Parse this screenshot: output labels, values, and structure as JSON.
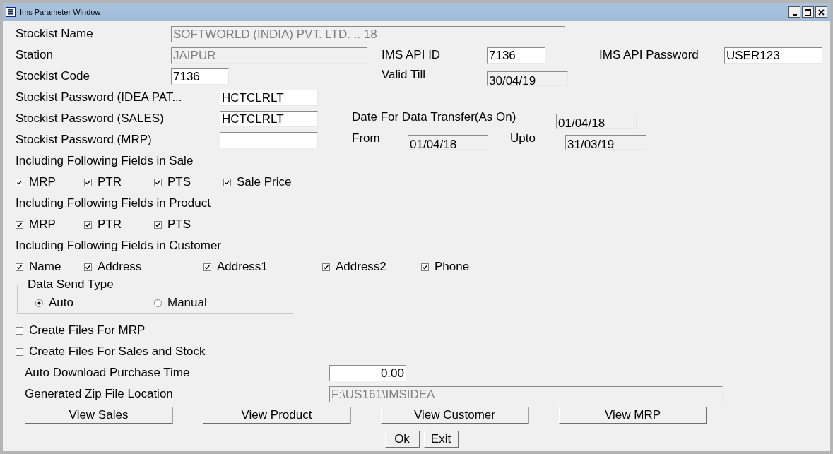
{
  "window": {
    "title": "Ims Parameter Window"
  },
  "stockist_name": {
    "label": "Stockist Name",
    "value": "SOFTWORLD (INDIA) PVT. LTD. .. 18",
    "disabled": true
  },
  "station": {
    "label": "Station",
    "value": "JAIPUR",
    "disabled": true
  },
  "ims_api_id": {
    "label": "IMS API ID",
    "value": "7136",
    "disabled": false
  },
  "ims_api_password": {
    "label": "IMS API Password",
    "value": "USER123",
    "disabled": false
  },
  "stockist_code": {
    "label": "Stockist Code",
    "value": "7136",
    "disabled": false
  },
  "valid_till": {
    "label": "Valid Till",
    "value": "30/04/19",
    "disabled": true
  },
  "password_idea": {
    "label": "Stockist Password (IDEA PAT...",
    "value": "HCTCLRLT",
    "disabled": false
  },
  "password_sales": {
    "label": "Stockist Password (SALES)",
    "value": "HCTCLRLT",
    "disabled": false
  },
  "password_mrp": {
    "label": "Stockist Password (MRP)",
    "disabled": false
  },
  "data_transfer_date": {
    "label": "Date For Data Transfer(As On)",
    "value": "01/04/18",
    "disabled": true
  },
  "from": {
    "label": "From",
    "value": "01/04/18",
    "disabled": true
  },
  "upto": {
    "label": "Upto",
    "value": "31/03/19",
    "disabled": true
  },
  "field_groups": [
    {
      "heading": "Including Following Fields in Sale",
      "options": [
        {
          "label": "MRP",
          "checked": true
        },
        {
          "label": "PTR",
          "checked": true
        },
        {
          "label": "PTS",
          "checked": true
        },
        {
          "label": "Sale Price",
          "checked": true
        }
      ]
    },
    {
      "heading": "Including Following Fields in Product",
      "options": [
        {
          "label": "MRP",
          "checked": true
        },
        {
          "label": "PTR",
          "checked": true
        },
        {
          "label": "PTS",
          "checked": true
        }
      ]
    },
    {
      "heading": "Including Following Fields in Customer",
      "options": [
        {
          "label": "Name",
          "checked": true
        },
        {
          "label": "Address",
          "checked": true
        },
        {
          "label": "Address1",
          "checked": true
        },
        {
          "label": "Address2",
          "checked": true
        },
        {
          "label": "Phone",
          "checked": true
        }
      ]
    }
  ],
  "data_send_type": {
    "legend": "Data Send Type",
    "options": [
      {
        "label": "Auto",
        "selected": true
      },
      {
        "label": "Manual",
        "selected": false
      }
    ]
  },
  "create_files": [
    {
      "label": "Create Files For MRP",
      "checked": false
    },
    {
      "label": "Create Files For Sales and Stock",
      "checked": false
    }
  ],
  "auto_download_time": {
    "label": "Auto Download Purchase Time",
    "value": "0.00",
    "disabled": false
  },
  "zip_location": {
    "label": "Generated Zip File Location",
    "value": "F:\\US161\\IMSIDEA",
    "disabled": true
  },
  "view_buttons": [
    "View Sales",
    "View Product",
    "View Customer",
    "View MRP"
  ],
  "dialog_buttons": [
    "Ok",
    "Exit"
  ]
}
